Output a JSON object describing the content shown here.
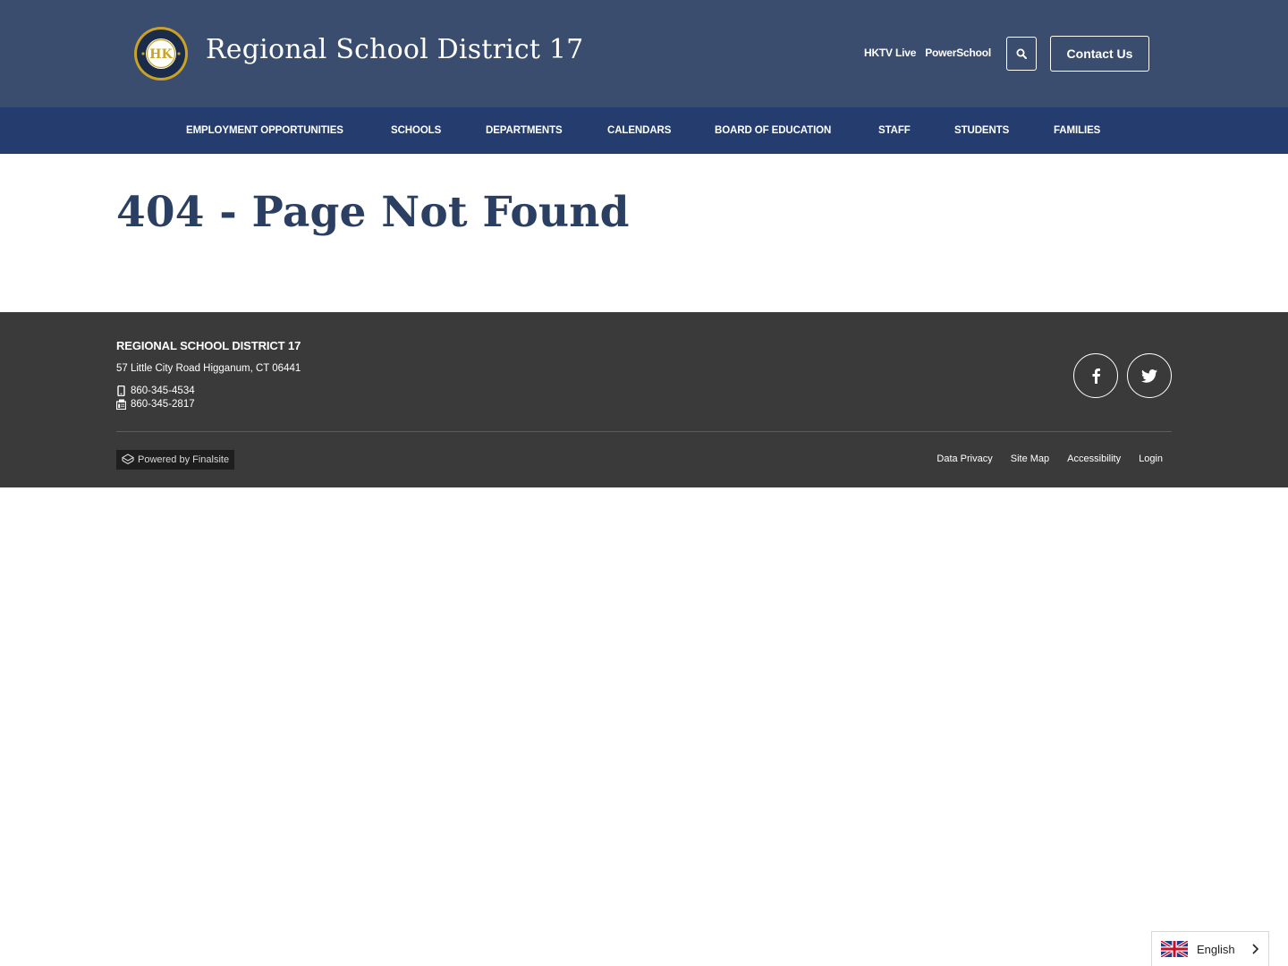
{
  "header": {
    "logo_icon": "district-seal-icon",
    "logo_text": "HK",
    "title": "Regional School District 17",
    "quick_links": [
      "HKTV Live",
      "PowerSchool"
    ],
    "search_icon": "search-icon",
    "contact_label": "Contact Us"
  },
  "nav": {
    "items": [
      "EMPLOYMENT OPPORTUNITIES",
      "SCHOOLS",
      "DEPARTMENTS",
      "CALENDARS",
      "BOARD OF EDUCATION",
      "STAFF",
      "STUDENTS",
      "FAMILIES"
    ]
  },
  "main": {
    "title": "404 - Page Not Found"
  },
  "footer": {
    "org_name": "REGIONAL SCHOOL DISTRICT 17",
    "address": "57 Little City Road Higganum, CT 06441",
    "phone": "860-345-4534",
    "phone_icon": "phone-icon",
    "fax": "860-345-2817",
    "fax_icon": "fax-icon",
    "social": [
      "facebook-icon",
      "twitter-icon"
    ],
    "powered_by": "Powered by Finalsite",
    "links": [
      "Data Privacy",
      "Site Map",
      "Accessibility",
      "Login"
    ]
  },
  "language": {
    "selected": "English",
    "flag_icon": "uk-flag-icon"
  },
  "colors": {
    "header_bg": "#3a4d6f",
    "nav_bg": "#243d6e",
    "title_color": "#2b3f63",
    "footer_bg": "#3a3a3a",
    "seal_gold": "#c9a227"
  }
}
